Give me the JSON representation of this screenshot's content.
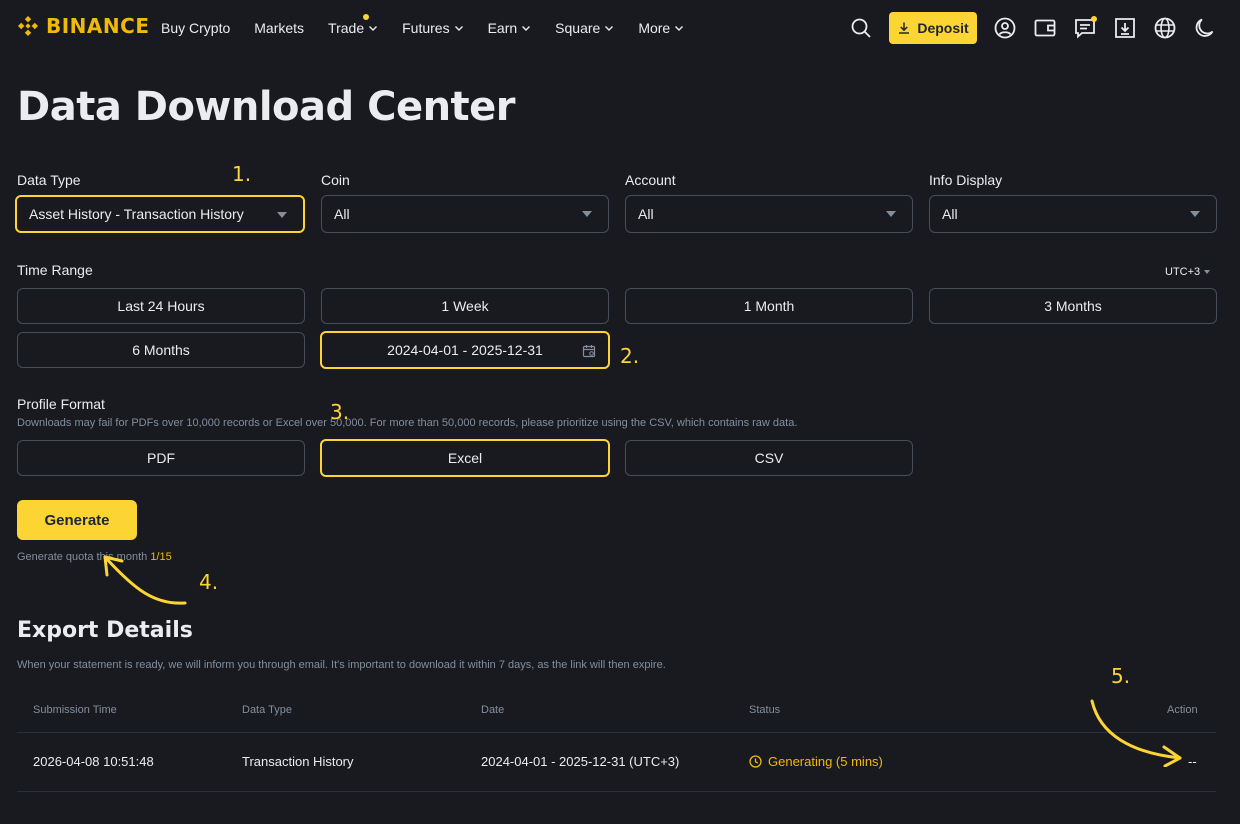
{
  "header": {
    "brand": "BINANCE",
    "nav": [
      {
        "label": "Buy Crypto",
        "has_chevron": false
      },
      {
        "label": "Markets",
        "has_chevron": false
      },
      {
        "label": "Trade",
        "has_chevron": true,
        "dot": true
      },
      {
        "label": "Futures",
        "has_chevron": true
      },
      {
        "label": "Earn",
        "has_chevron": true
      },
      {
        "label": "Square",
        "has_chevron": true
      },
      {
        "label": "More",
        "has_chevron": true
      }
    ],
    "deposit_label": "Deposit",
    "icons": [
      "search-icon",
      "download-arrow-icon",
      "user-icon",
      "wallet-icon",
      "messages-icon",
      "app-download-icon",
      "globe-icon",
      "moon-icon"
    ]
  },
  "page_title": "Data Download Center",
  "filters": {
    "data_type": {
      "label": "Data Type",
      "value": "Asset History - Transaction History"
    },
    "coin": {
      "label": "Coin",
      "value": "All"
    },
    "account": {
      "label": "Account",
      "value": "All"
    },
    "info_display": {
      "label": "Info Display",
      "value": "All"
    }
  },
  "time_range": {
    "label": "Time Range",
    "timezone": "UTC+3",
    "options": [
      "Last 24 Hours",
      "1 Week",
      "1 Month",
      "3 Months",
      "6 Months"
    ],
    "custom_range": "2024-04-01 - 2025-12-31"
  },
  "profile_format": {
    "label": "Profile Format",
    "note": "Downloads may fail for PDFs over 10,000 records or Excel over 50,000. For more than 50,000 records, please prioritize using the CSV, which contains raw data.",
    "options": [
      "PDF",
      "Excel",
      "CSV"
    ],
    "selected": "Excel"
  },
  "generate": {
    "label": "Generate",
    "quota_text": "Generate quota this month",
    "quota_value": "1/15"
  },
  "annotations": {
    "a1": "1.",
    "a2": "2.",
    "a3": "3.",
    "a4": "4.",
    "a5": "5."
  },
  "export": {
    "title": "Export Details",
    "note": "When your statement is ready, we will inform you through email. It's important to download it within 7 days, as the link will then expire.",
    "columns": [
      "Submission Time",
      "Data Type",
      "Date",
      "Status",
      "Action"
    ],
    "rows": [
      {
        "submission_time": "2026-04-08 10:51:48",
        "data_type": "Transaction History",
        "date": "2024-04-01 - 2025-12-31 (UTC+3)",
        "status": "Generating (5 mins)",
        "action": "--"
      }
    ]
  },
  "colors": {
    "accent": "#fcd535",
    "bg": "#181a20",
    "border": "#474d57",
    "muted": "#848e9c",
    "status": "#f0b90b"
  }
}
